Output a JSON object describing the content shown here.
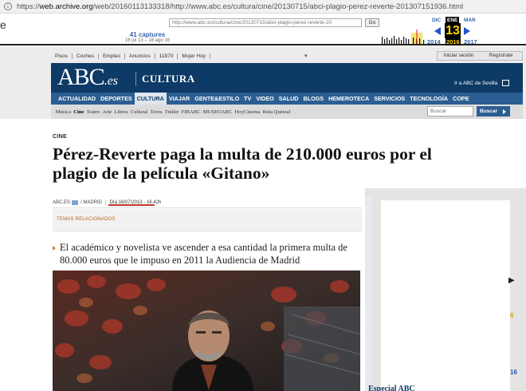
{
  "browser": {
    "url_prefix": "https://",
    "url_host": "web.archive.org",
    "url_path": "/web/20160113133318/http://www.abc.es/cultura/cine/20130715/abci-plagio-perez-reverte-201307151936.html"
  },
  "wayback": {
    "left_glyph": "e",
    "captures_count": "41 captures",
    "captures_range": "16 jul 13 – 18 ago 16",
    "archived_url": "http://www.abc.es/cultura/cine/20130715/abci-plagio-perez-reverte-20",
    "go_label": "Go",
    "months": {
      "prev": "DIC",
      "current": "ENE",
      "next": "MAR"
    },
    "day": "13",
    "years": {
      "prev": "2014",
      "current": "2016",
      "next": "2017"
    }
  },
  "topnav": {
    "items": [
      "Pisos",
      "Coches",
      "Empleo",
      "Anuncios",
      "11870",
      "Mujer Hoy"
    ],
    "caret": "▾",
    "login": "Iniciar sesión",
    "register": "Regístrate"
  },
  "header": {
    "logo_main": "ABC",
    "logo_suffix": ".es",
    "section": "CULTURA",
    "sevilla_link": "Ir a ABC de Sevilla"
  },
  "mainnav": {
    "items": [
      "ACTUALIDAD",
      "DEPORTES",
      "CULTURA",
      "VIAJAR",
      "GENTE&ESTILO",
      "TV",
      "VIDEO",
      "SALUD",
      "BLOGS",
      "HEMEROTECA",
      "SERVICIOS",
      "TECNOLOGÍA",
      "COPE"
    ],
    "active": "CULTURA"
  },
  "subnav": {
    "items": [
      "Música",
      "Cine",
      "Teatro",
      "Arte",
      "Libros",
      "Cultural",
      "Toros",
      "Tráiler",
      "FIBABC",
      "MUSEOABC",
      "HoyCinema",
      "Ruta Quetzal"
    ],
    "active": "Cine",
    "search_placeholder": "Buscar",
    "search_button": "Buscar"
  },
  "article": {
    "kicker": "CINE",
    "headline": "Pérez-Reverte paga la multa de 210.000 euros por el plagio de la película «Gitano»",
    "source": "ABC.ES",
    "location": "MADRID",
    "date": "Día 16/07/2013 - 16.42h",
    "related_topics": "TEMAS RELACIONADOS",
    "lead": "El académico y novelista ve ascender a esa cantidad la primera multa de 80.000 euros que le impuso en 2011 la Audiencia de Madrid"
  },
  "sidebar": {
    "edge_numbers": [
      "6",
      "16"
    ],
    "footer_title": "Especial ABC"
  },
  "colors": {
    "abc_navy": "#0d3a66",
    "nav_blue": "#2b5e92",
    "accent_red": "#c0392b",
    "wayback_gold": "#ffd700"
  }
}
